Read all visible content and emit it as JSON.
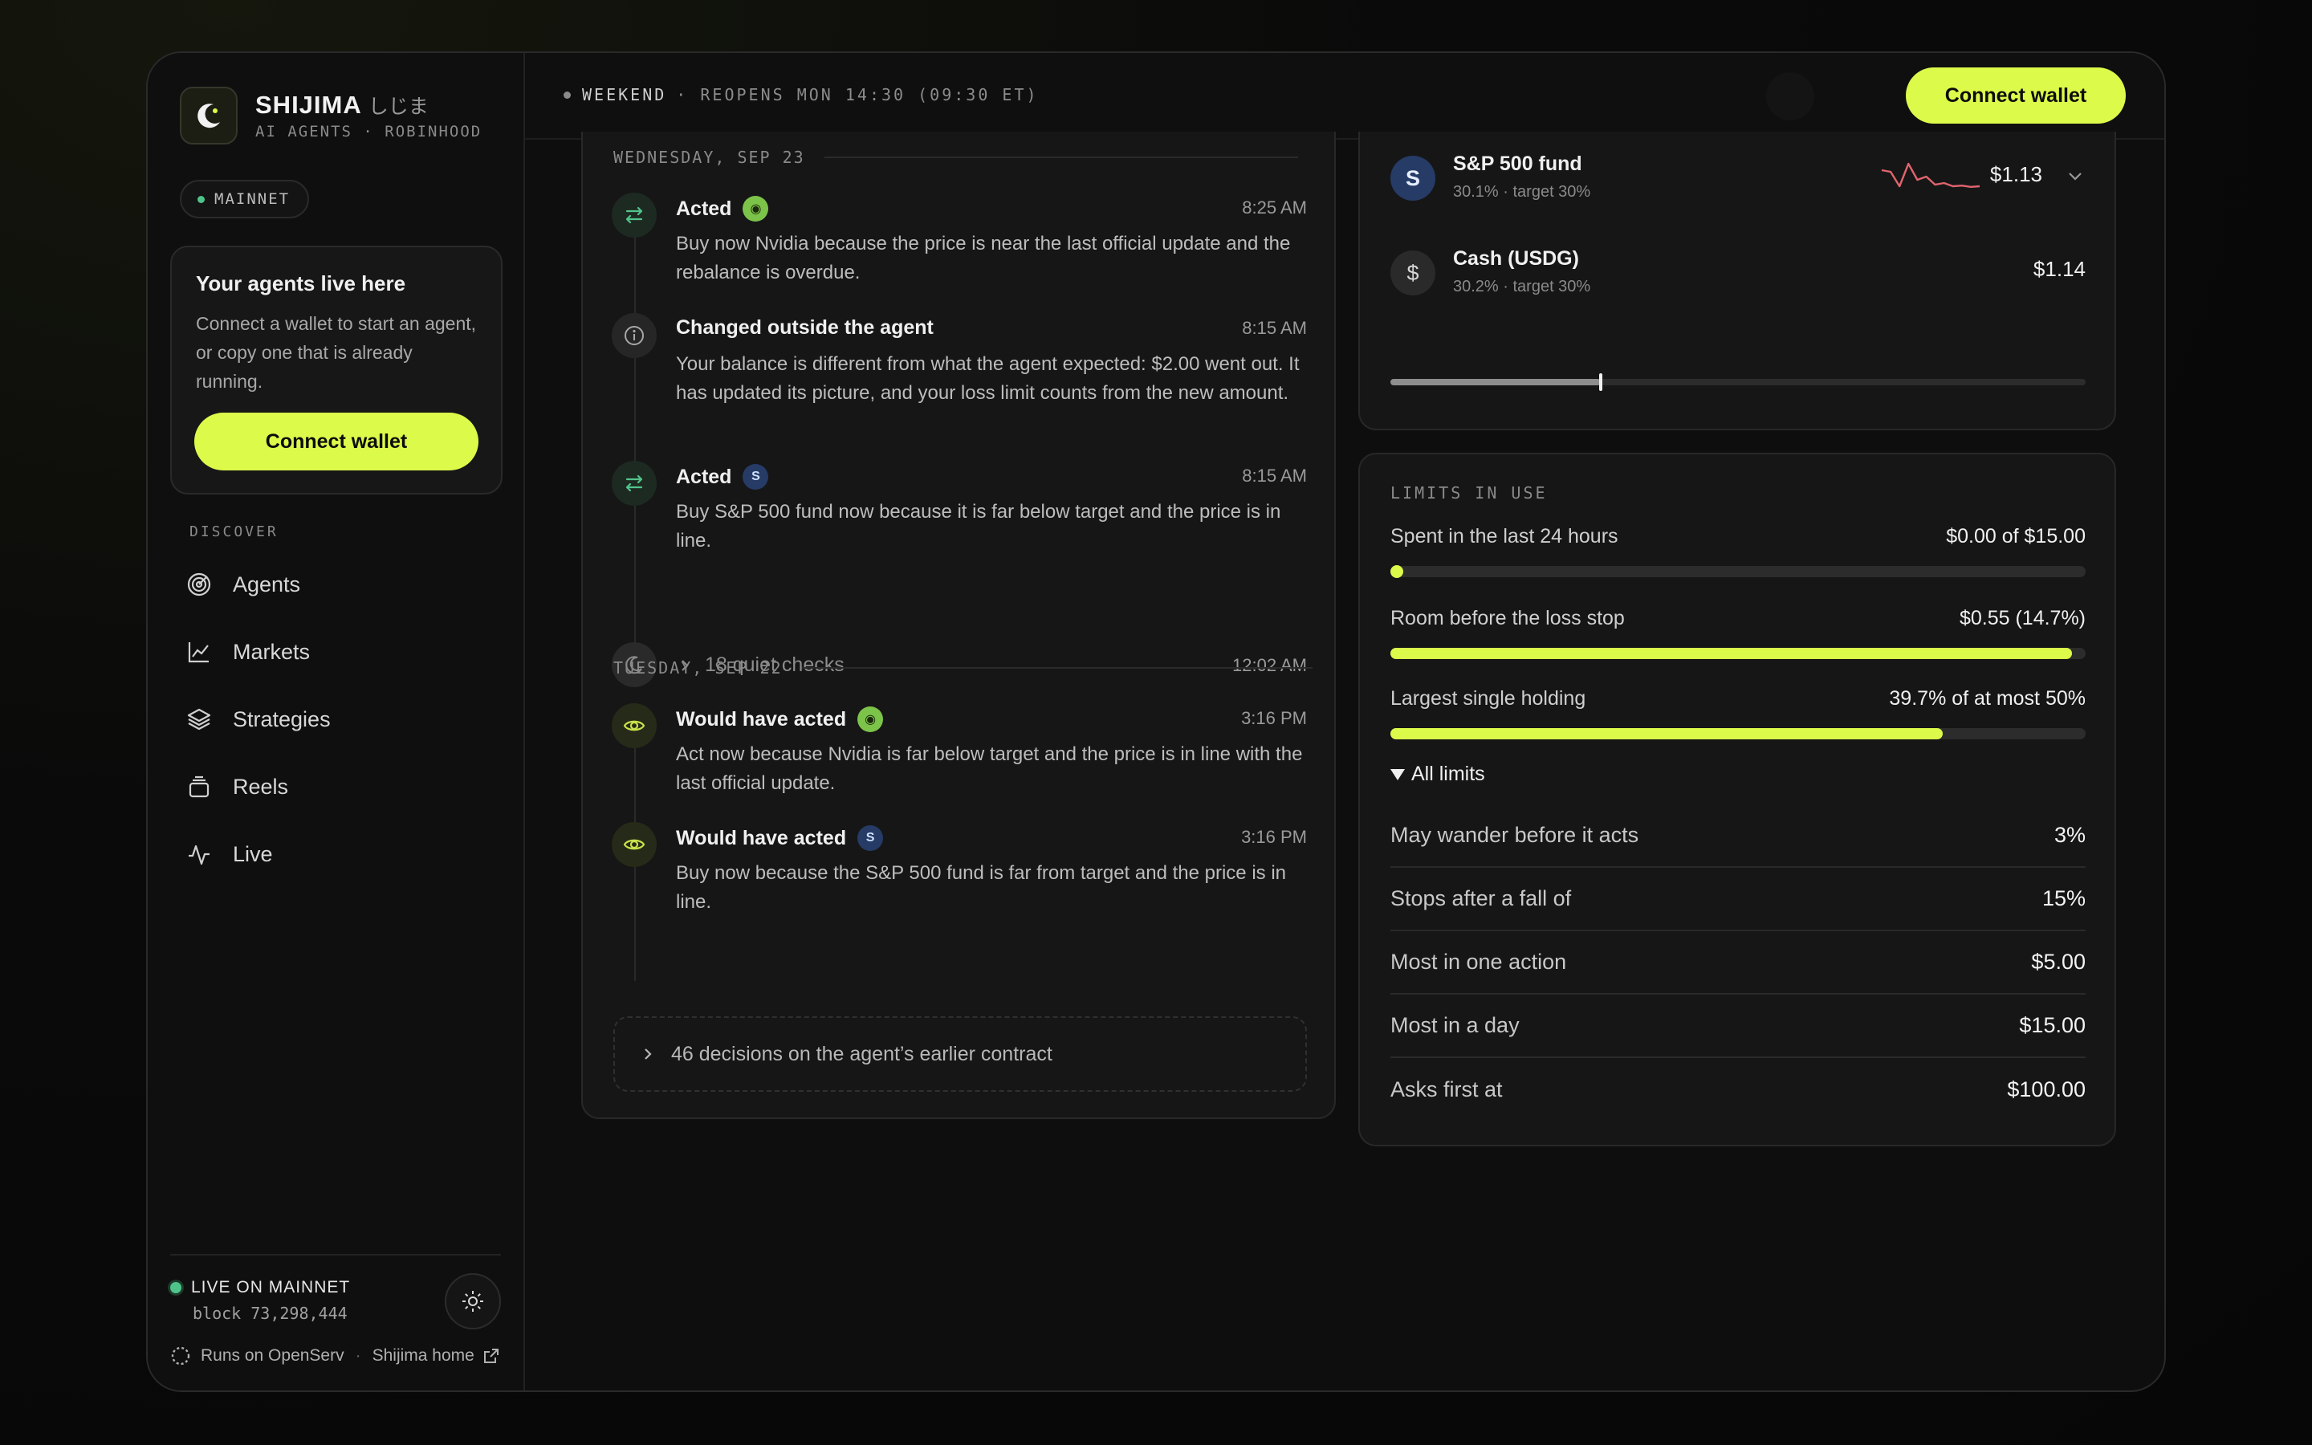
{
  "brand": {
    "name": "SHIJIMA",
    "jp": "しじま",
    "sub": "AI AGENTS · ROBINHOOD"
  },
  "network": {
    "label": "MAINNET"
  },
  "agents_card": {
    "title": "Your agents live here",
    "body": "Connect a wallet to start an agent, or copy one that is already running.",
    "button": "Connect wallet"
  },
  "nav": {
    "heading": "DISCOVER",
    "items": [
      {
        "label": "Agents",
        "icon": "radar-icon"
      },
      {
        "label": "Markets",
        "icon": "chart-line-icon"
      },
      {
        "label": "Strategies",
        "icon": "layers-icon"
      },
      {
        "label": "Reels",
        "icon": "reels-icon"
      },
      {
        "label": "Live",
        "icon": "pulse-icon"
      }
    ]
  },
  "footer": {
    "live_label": "LIVE ON MAINNET",
    "block": "block 73,298,444",
    "runs_on": "Runs on OpenServ",
    "sep": "·",
    "home_link": "Shijima home"
  },
  "topbar": {
    "status_state": "WEEKEND",
    "status_detail": "· REOPENS MON 14:30 (09:30 ET)",
    "connect_button": "Connect wallet"
  },
  "activity": {
    "days": [
      {
        "label": "WEDNESDAY, SEP 23",
        "events": [
          {
            "kind": "acted",
            "title": "Acted",
            "token": "nvidia",
            "time": "8:25 AM",
            "body": "Buy now Nvidia because the price is near the last official update and the rebalance is overdue."
          },
          {
            "kind": "external",
            "title": "Changed outside the agent",
            "token": "",
            "time": "8:15 AM",
            "body": "Your balance is different from what the agent expected: $2.00 went out. It has updated its picture, and your loss limit counts from the new amount."
          },
          {
            "kind": "acted",
            "title": "Acted",
            "token": "sp500",
            "time": "8:15 AM",
            "body": "Buy S&P 500 fund now because it is far below target and the price is in line."
          }
        ],
        "quiet": {
          "label": "18 quiet checks",
          "time": "12:02 AM"
        }
      },
      {
        "label": "TUESDAY, SEP 22",
        "events": [
          {
            "kind": "would",
            "title": "Would have acted",
            "token": "nvidia",
            "time": "3:16 PM",
            "body": "Act now because Nvidia is far below target and the price is in line with the last official update."
          },
          {
            "kind": "would",
            "title": "Would have acted",
            "token": "sp500",
            "time": "3:16 PM",
            "body": "Buy now because the S&P 500 fund is far from target and the price is in line."
          }
        ]
      }
    ],
    "earlier": "46 decisions on the agent’s earlier contract"
  },
  "holdings": {
    "items": [
      {
        "symbol": "S",
        "name": "S&P 500 fund",
        "sub": "30.1% · target 30%",
        "value": "$1.13",
        "sparkline": [
          0.3,
          0.35,
          0.8,
          0.1,
          0.6,
          0.5,
          0.75,
          0.7,
          0.8,
          0.78,
          0.82,
          0.8
        ],
        "spark_color": "#e0646e"
      },
      {
        "symbol": "$",
        "name": "Cash (USDG)",
        "sub": "30.2% · target 30%",
        "value": "$1.14"
      }
    ],
    "allocation_fraction": 0.302
  },
  "limits": {
    "heading": "LIMITS IN USE",
    "meters": [
      {
        "label": "Spent in the last 24 hours",
        "value": "$0.00 of $15.00",
        "fraction": 0
      },
      {
        "label": "Room before the loss stop",
        "value": "$0.55 (14.7%)",
        "fraction": 0.98
      },
      {
        "label": "Largest single holding",
        "value": "39.7% of at most 50%",
        "fraction": 0.794
      }
    ],
    "toggle": "All limits",
    "rows": [
      {
        "label": "May wander before it acts",
        "value": "3%"
      },
      {
        "label": "Stops after a fall of",
        "value": "15%"
      },
      {
        "label": "Most in one action",
        "value": "$5.00"
      },
      {
        "label": "Most in a day",
        "value": "$15.00"
      },
      {
        "label": "Asks first at",
        "value": "$100.00"
      }
    ]
  },
  "colors": {
    "accent": "#dcfa4a",
    "live": "#4ec48a",
    "panel": "#161616"
  }
}
